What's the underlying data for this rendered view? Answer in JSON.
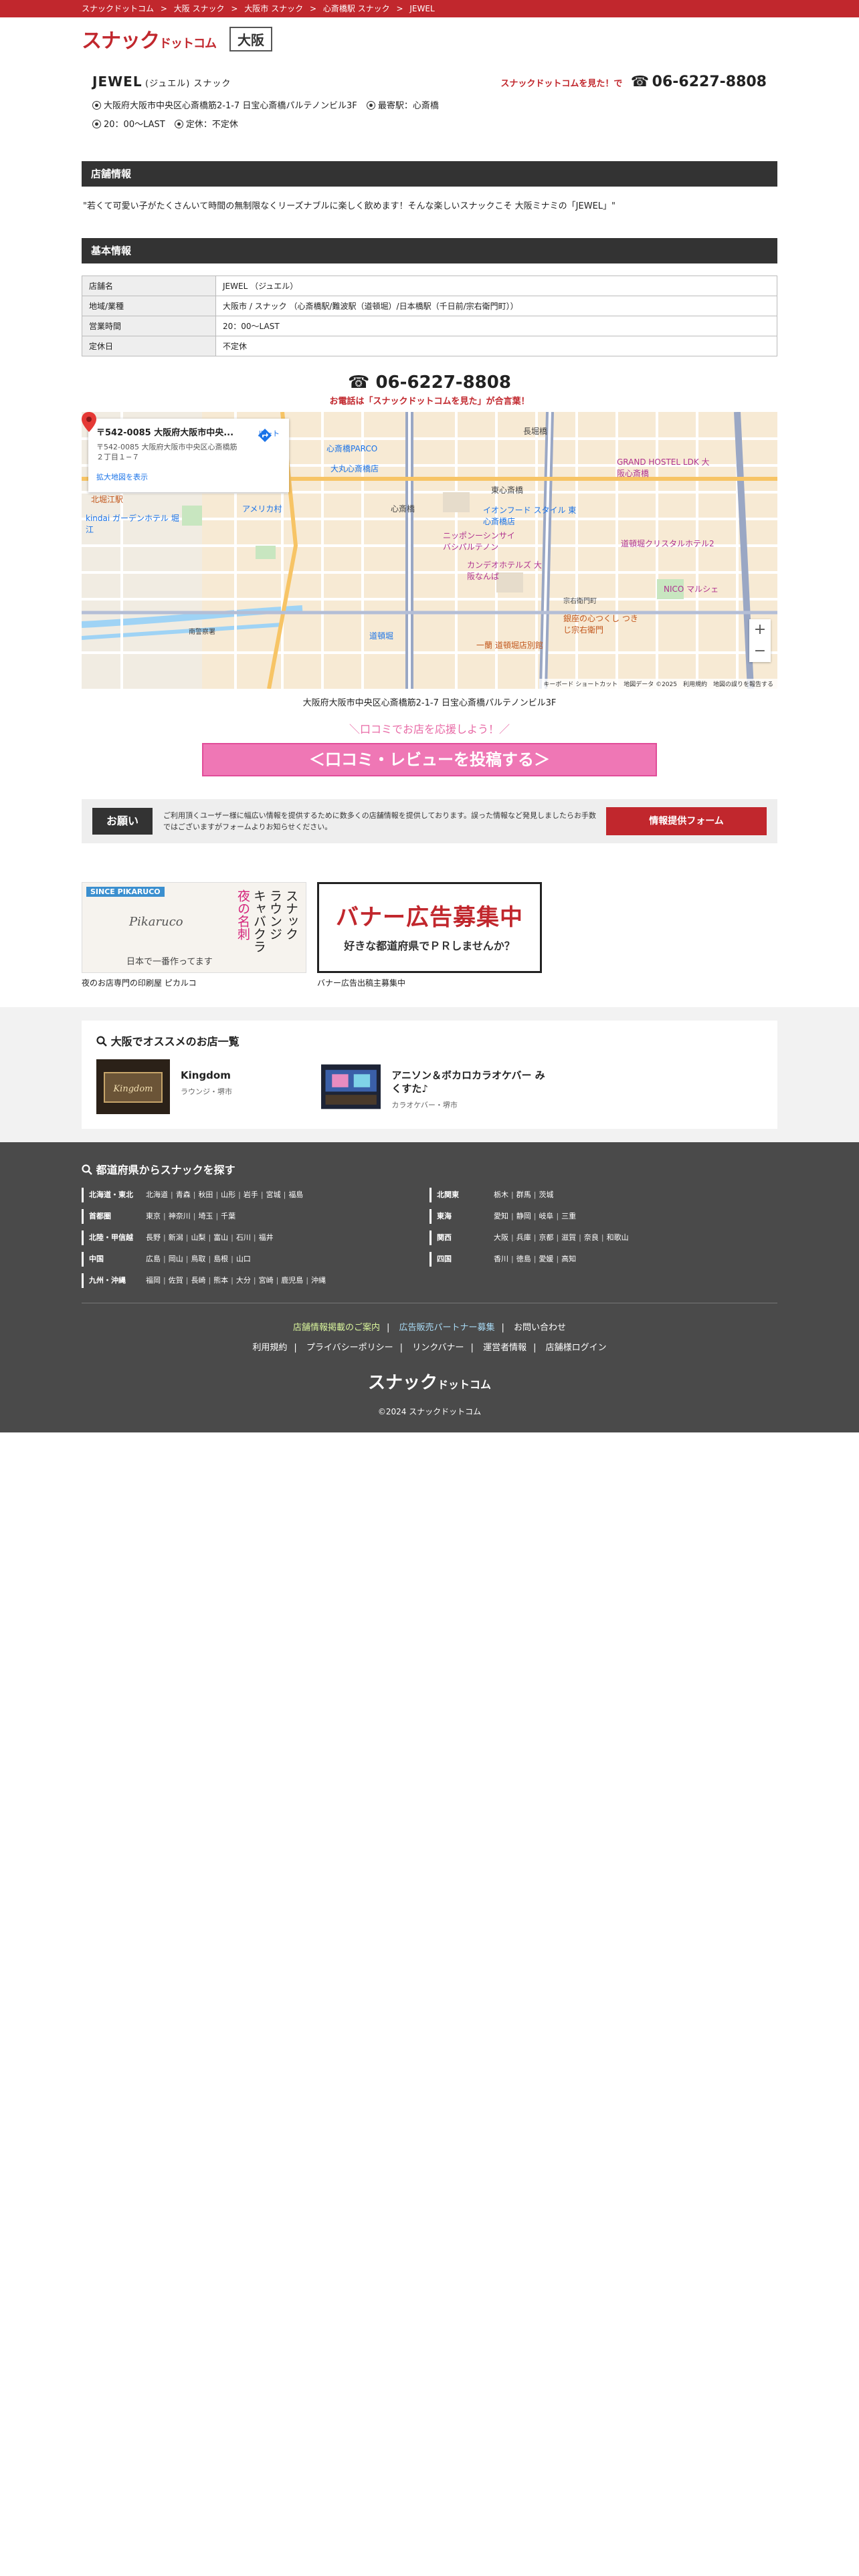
{
  "breadcrumb": [
    "スナックドットコム",
    ">",
    "大阪 スナック",
    ">",
    "大阪市 スナック",
    ">",
    "心斎橋駅 スナック",
    ">",
    "JEWEL"
  ],
  "header": {
    "logo_main": "スナック",
    "logo_sub": "ドットコム",
    "area": "大阪"
  },
  "shop": {
    "name": "JEWEL",
    "name_sub": "(ジュエル) スナック",
    "tel_note": "スナックドットコムを見た！で",
    "tel_icon": "☎",
    "tel": "06-6227-8808",
    "address": "大阪府大阪市中央区心斎橋筋2-1-7 日宝心斎橋パルテノンビル3F",
    "station": "最寄駅：心斎橋",
    "hours": "20：00～LAST",
    "holiday": "定休：不定休"
  },
  "sections": {
    "info": "店舗情報",
    "basic": "基本情報"
  },
  "description": "\"若くて可愛い子がたくさんいて時間の無制限なくリーズナブルに楽しく飲めます！そんな楽しいスナックこそ 大阪ミナミの「JEWEL」\"",
  "basic_table": [
    {
      "k": "店舗名",
      "v": "JEWEL （ジュエル）"
    },
    {
      "k": "地域/業種",
      "v": "大阪市 / スナック （心斎橋駅/難波駅（道頓堀）/日本橋駅（千日前/宗右衛門町））"
    },
    {
      "k": "営業時間",
      "v": "20：00～LAST"
    },
    {
      "k": "定休日",
      "v": "不定休"
    }
  ],
  "tel_block": {
    "icon": "☎",
    "num": "06-6227-8808",
    "note": "お電話は「スナックドットコムを見た」が合言葉！"
  },
  "map": {
    "card_addr": "〒542-0085 大阪府大阪市中央...",
    "card_sub": "〒542-0085 大阪府大阪市中央区心斎橋筋２丁目１−７",
    "card_link": "拡大地図を表示",
    "route": "ルート",
    "labels": {
      "parco": "心斎橋PARCO",
      "daimaru": "大丸心斎橋店",
      "nagahori": "長堀橋",
      "higashi": "東心斎橋",
      "hostel": "GRAND HOSTEL LDK 大阪心斎橋",
      "shinsaibashi": "心斎橋",
      "nippon": "ニッポンーシンサイ バシパルテノン",
      "ionfood": "イオンフード スタイル 東心斎橋店",
      "dotonbori_hotel": "道頓堀クリスタルホテル2",
      "candeo": "カンデオホテルズ 大阪なんば",
      "nico": "NICO マルシェ",
      "america": "アメリカ村",
      "kindai": "kindai ガーデンホテル 堀江",
      "kitahori": "北堀江駅",
      "ginza": "銀座の心つくし つきじ宗右衛門",
      "ichiran": "一蘭 道頓堀店別館",
      "dotonbori": "道頓堀",
      "keisatsu": "南警察署",
      "sakae": "宗右衛門町",
      "footer": "キーボード ショートカット　地図データ ©2025　利用規約　地図の誤りを報告する"
    },
    "caption": "大阪府大阪市中央区心斎橋筋2-1-7 日宝心斎橋パルテノンビル3F"
  },
  "review": {
    "head": "＼口コミでお店を応援しよう！／",
    "button": "＜口コミ・レビューを投稿する＞"
  },
  "onegai": {
    "label": "お願い",
    "text": "ご利用頂くユーザー様に幅広い情報を提供するために数多くの店舗情報を提供しております。誤った情報など発見しましたらお手数ではございますがフォームよりお知らせください。",
    "button": "情報提供フォーム"
  },
  "banners": [
    {
      "logo": "SINCE PIKARUCO",
      "brand": "Pikaruco",
      "vert_1": "スナック",
      "vert_2": "ラウンジ",
      "vert_3": "キャバクラ",
      "vert_4": "夜の名刺",
      "tag": "日本で一番作ってます",
      "caption": "夜のお店専門の印刷屋 ピカルコ"
    },
    {
      "big": "バナー広告募集中",
      "small": "好きな都道府県でＰＲしませんか？",
      "caption": "バナー広告出稿主募集中"
    }
  ],
  "recommend": {
    "title": "大阪でオススメのお店一覧",
    "items": [
      {
        "name": "Kingdom",
        "meta": "ラウンジ・堺市"
      },
      {
        "name": "アニソン＆ボカロカラオケバー みくすた♪",
        "meta": "カラオケバー・堺市"
      }
    ]
  },
  "footer": {
    "title": "都道府県からスナックを探す",
    "regions": [
      {
        "name": "北海道・東北",
        "prefs": [
          "北海道",
          "青森",
          "秋田",
          "山形",
          "岩手",
          "宮城",
          "福島"
        ]
      },
      {
        "name": "北関東",
        "prefs": [
          "栃木",
          "群馬",
          "茨城"
        ]
      },
      {
        "name": "首都圏",
        "prefs": [
          "東京",
          "神奈川",
          "埼玉",
          "千葉"
        ]
      },
      {
        "name": "東海",
        "prefs": [
          "愛知",
          "静岡",
          "岐阜",
          "三重"
        ]
      },
      {
        "name": "北陸・甲信越",
        "prefs": [
          "長野",
          "新潟",
          "山梨",
          "富山",
          "石川",
          "福井"
        ]
      },
      {
        "name": "関西",
        "prefs": [
          "大阪",
          "兵庫",
          "京都",
          "滋賀",
          "奈良",
          "和歌山"
        ]
      },
      {
        "name": "中国",
        "prefs": [
          "広島",
          "岡山",
          "鳥取",
          "島根",
          "山口"
        ]
      },
      {
        "name": "四国",
        "prefs": [
          "香川",
          "徳島",
          "愛媛",
          "高知"
        ]
      },
      {
        "name": "九州・沖縄",
        "prefs": [
          "福岡",
          "佐賀",
          "長崎",
          "熊本",
          "大分",
          "宮崎",
          "鹿児島",
          "沖縄"
        ]
      }
    ],
    "links1": [
      "店舗情報掲載のご案内",
      "広告販売パートナー募集",
      "お問い合わせ"
    ],
    "links2": [
      "利用規約",
      "プライバシーポリシー",
      "リンクバナー",
      "運営者情報",
      "店舗様ログイン"
    ],
    "logo_main": "スナック",
    "logo_sub": "ドットコム",
    "copy": "©2024 スナックドットコム"
  },
  "colors": {
    "brand": "#c1272d",
    "pink": "#ef77b5",
    "dark": "#333333",
    "footer": "#4a4a4a"
  }
}
